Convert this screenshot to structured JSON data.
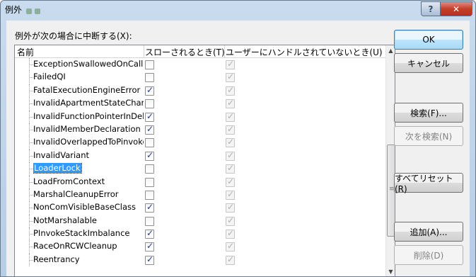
{
  "window": {
    "title": "例外"
  },
  "prompt": "例外が次の場合に中断する(X):",
  "columns": {
    "name": "名前",
    "thrown": "スローされるとき(T)",
    "unhandled": "ユーザーにハンドルされていないとき(U)"
  },
  "exceptions": [
    {
      "name": "ExceptionSwallowedOnCallFromCom",
      "thrown": false,
      "unhandled": true
    },
    {
      "name": "FailedQI",
      "thrown": false,
      "unhandled": true
    },
    {
      "name": "FatalExecutionEngineError",
      "thrown": true,
      "unhandled": true
    },
    {
      "name": "InvalidApartmentStateChange",
      "thrown": false,
      "unhandled": true
    },
    {
      "name": "InvalidFunctionPointerInDelegate",
      "thrown": true,
      "unhandled": true
    },
    {
      "name": "InvalidMemberDeclaration",
      "thrown": true,
      "unhandled": true
    },
    {
      "name": "InvalidOverlappedToPinvoke",
      "thrown": false,
      "unhandled": true
    },
    {
      "name": "InvalidVariant",
      "thrown": true,
      "unhandled": true
    },
    {
      "name": "LoaderLock",
      "thrown": false,
      "unhandled": true,
      "selected": true
    },
    {
      "name": "LoadFromContext",
      "thrown": false,
      "unhandled": true
    },
    {
      "name": "MarshalCleanupError",
      "thrown": false,
      "unhandled": true
    },
    {
      "name": "NonComVisibleBaseClass",
      "thrown": true,
      "unhandled": true
    },
    {
      "name": "NotMarshalable",
      "thrown": false,
      "unhandled": true
    },
    {
      "name": "PInvokeStackImbalance",
      "thrown": true,
      "unhandled": true
    },
    {
      "name": "RaceOnRCWCleanup",
      "thrown": true,
      "unhandled": true
    },
    {
      "name": "Reentrancy",
      "thrown": true,
      "unhandled": true
    }
  ],
  "buttons": {
    "ok": "OK",
    "cancel": "キャンセル",
    "find": "検索(F)...",
    "find_next": "次を検索(N)",
    "reset_all": "すべてリセット(R)",
    "add": "追加(A)...",
    "delete": "削除(D)"
  },
  "icons": {
    "help": "help-icon",
    "close": "close-icon",
    "scroll_up": "scroll-up-arrow-icon",
    "scroll_down": "scroll-down-arrow-icon",
    "check": "check-icon"
  },
  "colors": {
    "selection": "#3399ff",
    "close_button": "#c4402a",
    "title_bar": "#c9dbee"
  }
}
